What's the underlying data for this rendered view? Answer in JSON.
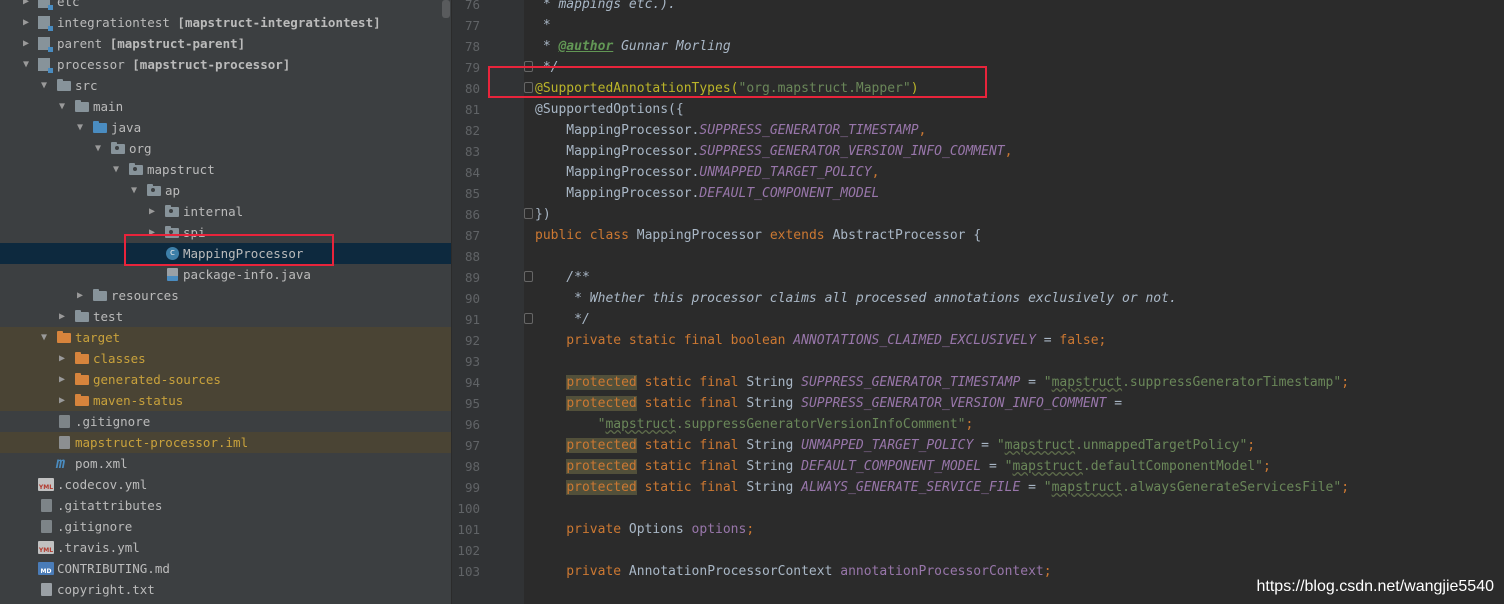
{
  "tree": {
    "rows": [
      {
        "label": "etc",
        "suffix": ""
      },
      {
        "label": "integrationtest",
        "suffix": "[mapstruct-integrationtest]"
      },
      {
        "label": "parent",
        "suffix": "[mapstruct-parent]"
      },
      {
        "label": "processor",
        "suffix": "[mapstruct-processor]"
      },
      {
        "label": "src",
        "suffix": ""
      },
      {
        "label": "main",
        "suffix": ""
      },
      {
        "label": "java",
        "suffix": ""
      },
      {
        "label": "org",
        "suffix": ""
      },
      {
        "label": "mapstruct",
        "suffix": ""
      },
      {
        "label": "ap",
        "suffix": ""
      },
      {
        "label": "internal",
        "suffix": ""
      },
      {
        "label": "spi",
        "suffix": ""
      },
      {
        "label": "MappingProcessor",
        "suffix": ""
      },
      {
        "label": "package-info.java",
        "suffix": ""
      },
      {
        "label": "resources",
        "suffix": ""
      },
      {
        "label": "test",
        "suffix": ""
      },
      {
        "label": "target",
        "suffix": ""
      },
      {
        "label": "classes",
        "suffix": ""
      },
      {
        "label": "generated-sources",
        "suffix": ""
      },
      {
        "label": "maven-status",
        "suffix": ""
      },
      {
        "label": ".gitignore",
        "suffix": ""
      },
      {
        "label": "mapstruct-processor.iml",
        "suffix": ""
      },
      {
        "label": "pom.xml",
        "suffix": ""
      },
      {
        "label": ".codecov.yml",
        "suffix": ""
      },
      {
        "label": ".gitattributes",
        "suffix": ""
      },
      {
        "label": ".gitignore",
        "suffix": ""
      },
      {
        "label": ".travis.yml",
        "suffix": ""
      },
      {
        "label": "CONTRIBUTING.md",
        "suffix": ""
      },
      {
        "label": "copyright.txt",
        "suffix": ""
      }
    ],
    "icon_labels": {
      "class": "c",
      "yml": "YML",
      "md": "MD",
      "maven": "m"
    }
  },
  "editor": {
    "line_numbers": [
      "76",
      "77",
      "78",
      "79",
      "80",
      "81",
      "82",
      "83",
      "84",
      "85",
      "86",
      "87",
      "88",
      "89",
      "90",
      "91",
      "92",
      "93",
      "94",
      "95",
      "96",
      "97",
      "98",
      "99",
      "100",
      "101",
      "102",
      "103"
    ],
    "lines": {
      "l76": " * mappings etc.).",
      "l77": " *",
      "l78a": " * ",
      "l78b": "@author",
      "l78c": " Gunnar Morling",
      "l79": " */",
      "l80a": "@SupportedAnnotationTypes(",
      "l80b": "\"org.mapstruct.Mapper\"",
      "l80c": ")",
      "l81": "@SupportedOptions({",
      "l82a": "    MappingProcessor.",
      "l82b": "SUPPRESS_GENERATOR_TIMESTAMP",
      "l82c": ",",
      "l83a": "    MappingProcessor.",
      "l83b": "SUPPRESS_GENERATOR_VERSION_INFO_COMMENT",
      "l83c": ",",
      "l84a": "    MappingProcessor.",
      "l84b": "UNMAPPED_TARGET_POLICY",
      "l84c": ",",
      "l85a": "    MappingProcessor.",
      "l85b": "DEFAULT_COMPONENT_MODEL",
      "l86": "})",
      "l87a": "public class ",
      "l87b": "MappingProcessor ",
      "l87c": "extends ",
      "l87d": "AbstractProcessor {",
      "l89": "    /**",
      "l90": "     * Whether this processor claims all processed annotations exclusively or not.",
      "l91": "     */",
      "l92a": "    private static final boolean ",
      "l92b": "ANNOTATIONS_CLAIMED_EXCLUSIVELY",
      "l92c": " = ",
      "l92d": "false",
      "l92e": ";",
      "protected": "protected",
      "sfs": " static final ",
      "String": "String ",
      "l94b": "SUPPRESS_GENERATOR_TIMESTAMP",
      "l94c": " = ",
      "l94d": "\"",
      "l94e": "mapstruct",
      "l94f": ".suppressGeneratorTimestamp\"",
      "l94g": ";",
      "l95b": "SUPPRESS_GENERATOR_VERSION_INFO_COMMENT",
      "l95c": " =",
      "l96a": "        \"",
      "l96b": "mapstruct",
      "l96c": ".suppressGeneratorVersionInfoComment\"",
      "l96d": ";",
      "l97b": "UNMAPPED_TARGET_POLICY",
      "l97c": " = ",
      "l97d": "\"",
      "l97e": "mapstruct",
      "l97f": ".unmappedTargetPolicy\"",
      "l97g": ";",
      "l98b": "DEFAULT_COMPONENT_MODEL",
      "l98c": " = ",
      "l98d": "\"",
      "l98e": "mapstruct",
      "l98f": ".defaultComponentModel\"",
      "l98g": ";",
      "l99b": "ALWAYS_GENERATE_SERVICE_FILE",
      "l99c": " = ",
      "l99d": "\"",
      "l99e": "mapstruct",
      "l99f": ".alwaysGenerateServicesFile\"",
      "l99g": ";",
      "l101a": "    private ",
      "l101b": "Options ",
      "l101c": "options",
      "l101d": ";",
      "l103a": "    private ",
      "l103b": "AnnotationProcessorContext ",
      "l103c": "annotationProcessorContext",
      "l103d": ";"
    }
  },
  "watermark": "https://blog.csdn.net/wangjie5540",
  "colors": {
    "tree_bg": "#3c3f41",
    "editor_bg": "#2b2b2b",
    "selection": "#0d293e",
    "highlight_box": "#e8243b",
    "keyword": "#cc7832",
    "string": "#6a8759",
    "annotation": "#bbb529",
    "constant": "#9876aa",
    "comment": "#629755"
  }
}
